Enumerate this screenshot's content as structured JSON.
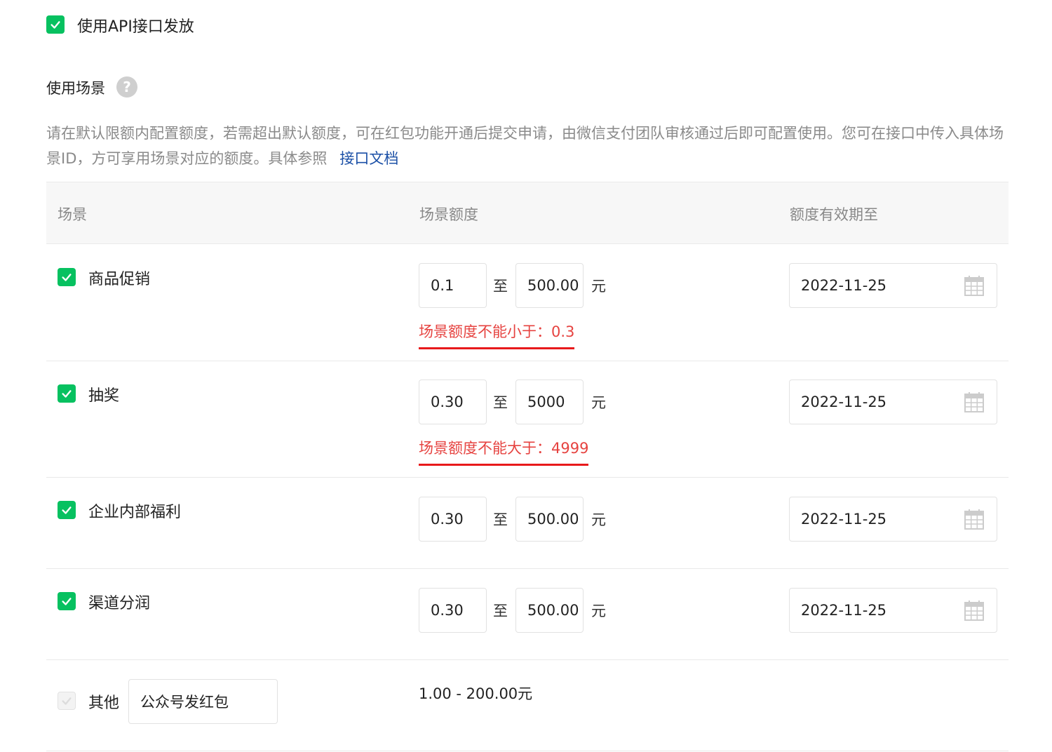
{
  "api": {
    "label": "使用API接口发放",
    "checked": true
  },
  "section": {
    "title": "使用场景",
    "help_icon": "question-circle-icon",
    "description": "请在默认限额内配置额度，若需超出默认额度，可在红包功能开通后提交申请，由微信支付团队审核通过后即可配置使用。您可在接口中传入具体场景ID，方可享用场景对应的额度。具体参照",
    "doc_link": "接口文档"
  },
  "table": {
    "headers": {
      "scene": "场景",
      "amount": "场景额度",
      "expiry": "额度有效期至"
    },
    "rows": [
      {
        "label": "商品促销",
        "min": "0.1",
        "sep": "至",
        "max": "500.00",
        "unit": "元",
        "date": "2022-11-25",
        "error": "场景额度不能小于：0.3"
      },
      {
        "label": "抽奖",
        "min": "0.30",
        "sep": "至",
        "max": "5000",
        "unit": "元",
        "date": "2022-11-25",
        "error": "场景额度不能大于：4999"
      },
      {
        "label": "企业内部福利",
        "min": "0.30",
        "sep": "至",
        "max": "500.00",
        "unit": "元",
        "date": "2022-11-25"
      },
      {
        "label": "渠道分润",
        "min": "0.30",
        "sep": "至",
        "max": "500.00",
        "unit": "元",
        "date": "2022-11-25"
      }
    ],
    "other": {
      "label": "其他",
      "input_value": "公众号发红包",
      "range": "1.00 - 200.00元"
    }
  },
  "colors": {
    "accent": "#07c160",
    "error": "#e64340",
    "link": "#1a4fa6"
  },
  "icons": {
    "checkbox": "check-icon",
    "calendar": "calendar-icon"
  }
}
